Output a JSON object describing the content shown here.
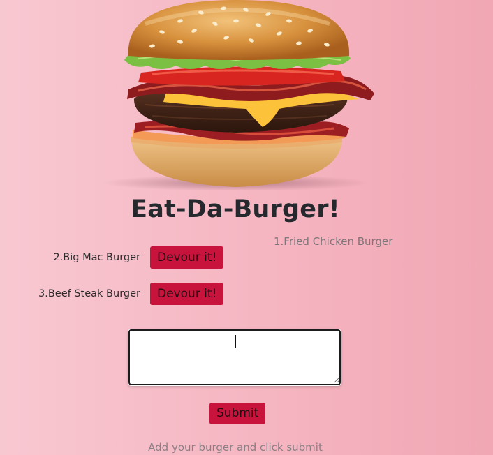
{
  "page": {
    "title": "Eat-Da-Burger!"
  },
  "hero": {
    "image": "cheeseburger-illustration"
  },
  "eaten": [
    {
      "label": "1.Fried Chicken Burger"
    }
  ],
  "to_devour": [
    {
      "label": "2.Big Mac Burger",
      "button": "Devour it!"
    },
    {
      "label": "3.Beef Steak Burger",
      "button": "Devour it!"
    }
  ],
  "form": {
    "input_value": "",
    "submit_label": "Submit",
    "hint": "Add your burger and click submit"
  },
  "colors": {
    "accent": "#c8143c",
    "background": "#f5b5c1",
    "title": "#25282c"
  }
}
